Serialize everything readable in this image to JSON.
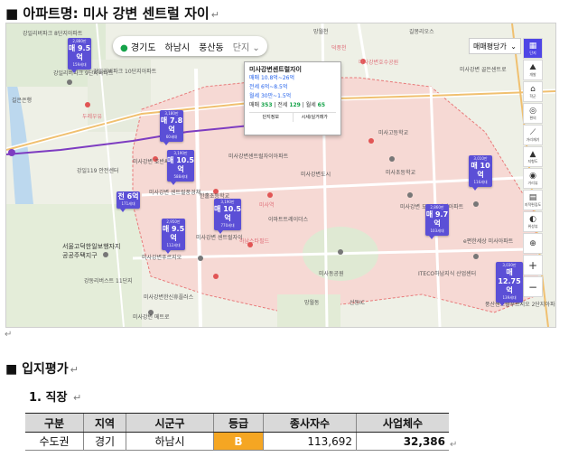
{
  "heading1": "■ 아파트명: 미사 강변 센트럴 자이",
  "return_mark": "↵",
  "map": {
    "region_tabs": [
      "경기도",
      "하남시",
      "풍산동"
    ],
    "complex_label": "단지",
    "price_dropdown": "매매평당가",
    "toolbar": [
      {
        "icon": "map-icon",
        "label": "단지"
      },
      {
        "icon": "road-icon",
        "label": "개발"
      },
      {
        "icon": "school-icon",
        "label": "학군"
      },
      {
        "icon": "subway-icon",
        "label": "편의"
      },
      {
        "icon": "ruler-icon",
        "label": "거리재기"
      },
      {
        "icon": "terrain-icon",
        "label": "지형도"
      },
      {
        "icon": "location-icon",
        "label": "거리뷰"
      },
      {
        "icon": "layers-icon",
        "label": "지적편집도"
      },
      {
        "icon": "satellite-icon",
        "label": "위성뷰"
      },
      {
        "icon": "target-icon",
        "label": ""
      },
      {
        "icon": "zoom-in-icon",
        "label": "+"
      },
      {
        "icon": "zoom-out-icon",
        "label": "−"
      }
    ],
    "markers": [
      {
        "top": "2,880만",
        "main": "매 9.5억",
        "sub": "159세대"
      },
      {
        "top": "3,180만",
        "main": "매 7.8억",
        "sub": "60세대"
      },
      {
        "top": "3,190만",
        "main": "매 10.5억",
        "sub": "588세대"
      },
      {
        "top": "",
        "main": "전 6억",
        "sub": "171세대"
      },
      {
        "top": "3,190만",
        "main": "매 10.5억",
        "sub": "770세대"
      },
      {
        "top": "2,950만",
        "main": "매 9.5억",
        "sub": "112세대"
      },
      {
        "top": "3,010만",
        "main": "매 10억",
        "sub": "116세대"
      },
      {
        "top": "2,860만",
        "main": "매 9.7억",
        "sub": "103세대"
      },
      {
        "top": "3,030만",
        "main": "매 12.75억",
        "sub": "139세대"
      }
    ],
    "infobox": {
      "title": "미사강변센트럴자이",
      "sale": "매매 10.8억~26억",
      "jeonse": "전세 6억~8.5억",
      "monthly": "월세 30만~1.5억",
      "counts_prefix": "매매",
      "sale_count": "353",
      "jeonse_label": "전세",
      "jeonse_count": "129",
      "monthly_label": "월세",
      "monthly_count": "65",
      "link1": "단지정보",
      "link2": "시세/실거래가"
    },
    "places": {
      "p01": "강일리버파크 8단지아파트",
      "p02": "강일리버파크 9단지아파트",
      "p03": "강일리버파크 10단지아파트",
      "p04": "길은은행",
      "p05": "두레우유",
      "p06": "미사강변 호반써밋",
      "p07": "미사강변센트럴자이아파트",
      "p08": "미사강변 센트럴풍경채",
      "p09": "한홀초등학교",
      "p10": "미사강변도시",
      "p11": "미사역",
      "p12": "하남스타필드",
      "p13": "미사강변푸르지오",
      "p14": "미사강변 센트럴자이",
      "p15": "미사강변 도시15단지아파트",
      "p16": "서울고덕한일보행자지",
      "p17": "공공주택지구",
      "p18": "강동리버스트 11단지",
      "p19": "미사강변한신휴플러스",
      "p20": "미사초등학교",
      "p21": "이마트트레이더스",
      "p22": "덕풍천",
      "p23": "미사동공원",
      "p24": "망월천",
      "p25": "미사강변호수공원",
      "p26": "e편한세상 미사아파트",
      "p27": "풍산센트럴푸르지오 2단지아파트",
      "p28": "ITECO하남지식 산업센터",
      "p29": "미사강변 골든센트로",
      "p30": "미사고등학교",
      "p31": "길몽리오스",
      "p32": "망월동",
      "p33": "선동IC",
      "p34": "강일119 안전센터",
      "p35": "미사강변 메트로"
    }
  },
  "stray_return": "↵",
  "heading2": "■ 입지평가",
  "heading3": "1. 직장",
  "jobs_table": {
    "headers": [
      "구분",
      "지역",
      "시군구",
      "등급",
      "종사자수",
      "사업체수"
    ],
    "row": [
      "수도권",
      "경기",
      "하남시",
      "B",
      "113,692",
      "32,386"
    ]
  }
}
